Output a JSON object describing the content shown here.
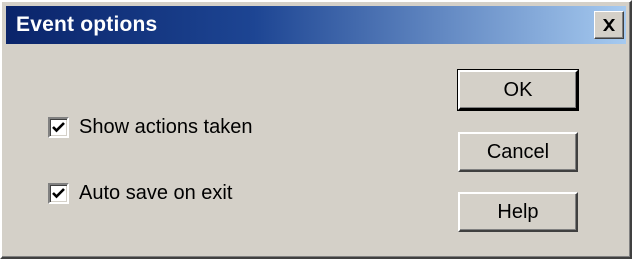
{
  "dialog": {
    "title": "Event options",
    "close_icon": "close-icon"
  },
  "options": [
    {
      "label": "Show actions taken",
      "checked": true
    },
    {
      "label": "Auto save on exit",
      "checked": true
    }
  ],
  "buttons": {
    "ok_label": "OK",
    "cancel_label": "Cancel",
    "help_label": "Help"
  },
  "colors": {
    "titlebar_start": "#0a246a",
    "titlebar_end": "#a6caf0",
    "face": "#d4d0c8"
  }
}
